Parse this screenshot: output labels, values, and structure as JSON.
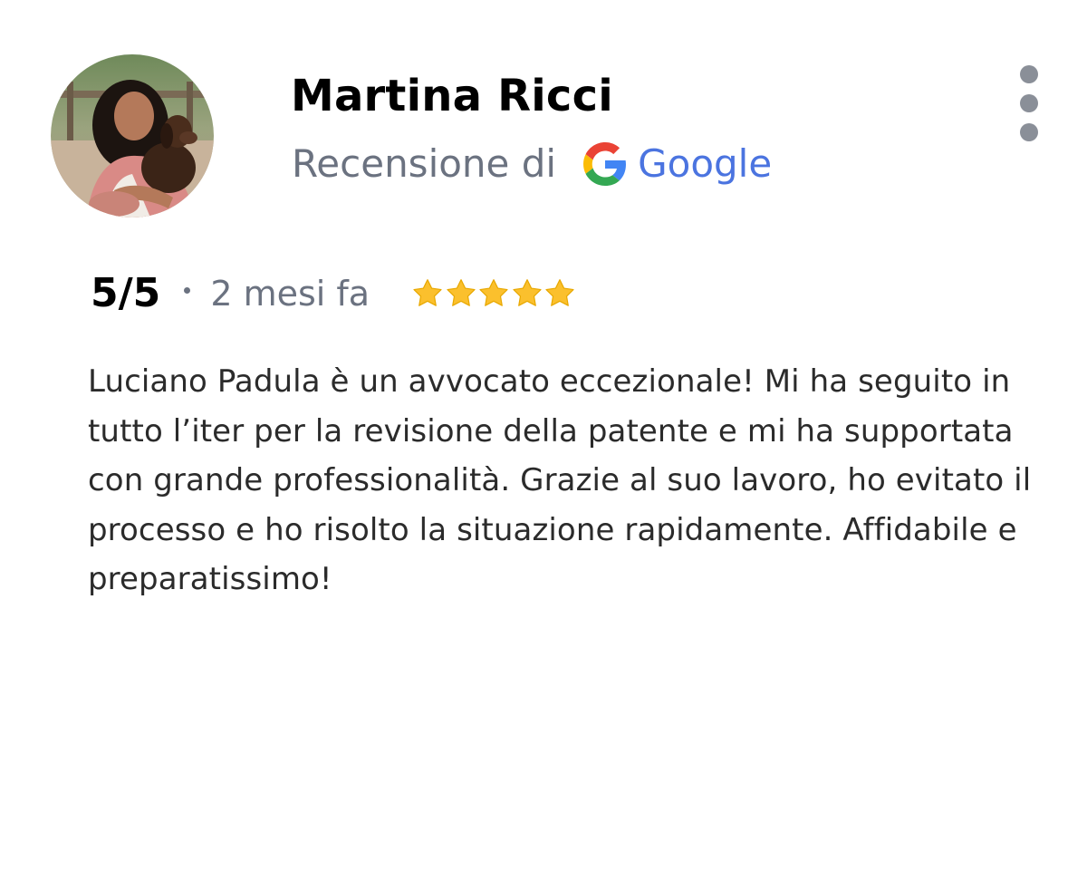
{
  "review": {
    "reviewer_name": "Martina Ricci",
    "source_prefix": "Recensione di",
    "source_name": "Google",
    "rating": 5,
    "rating_max": 5,
    "rating_text": "5/5",
    "time_ago": "2 mesi fa",
    "text": "Luciano Padula è un avvocato eccezionale! Mi ha seguito in tutto l’iter per la revisione della patente e mi ha supportata con grande professionalità. Grazie al suo lavoro, ho evitato il processo e ho risolto la situazione rapidamente. Affidabile e preparatissimo!"
  },
  "icons": {
    "avatar": "reviewer-photo",
    "source_logo": "google-g-icon",
    "menu": "more-vertical-icon",
    "rating_symbol": "star-icon"
  },
  "colors": {
    "star": "#FBC02D",
    "google_blue": "#4B74E0",
    "secondary_text": "#6B7280",
    "menu_dots": "#8A8F98"
  }
}
